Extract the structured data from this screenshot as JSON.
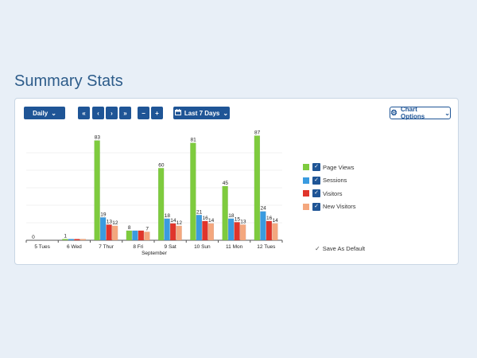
{
  "page": {
    "title": "Summary Stats"
  },
  "toolbar": {
    "period_label": "Daily",
    "nav": {
      "first": "«",
      "prev": "‹",
      "next": "›",
      "last": "»"
    },
    "zoom_out": "−",
    "zoom_in": "+",
    "range_label": "Last 7 Days",
    "chart_options_label": "Chart Options"
  },
  "legend": {
    "items": [
      {
        "label": "Page Views",
        "color": "#7ecb3e"
      },
      {
        "label": "Sessions",
        "color": "#3a9be0"
      },
      {
        "label": "Visitors",
        "color": "#e0352b"
      },
      {
        "label": "New Visitors",
        "color": "#f4a77e"
      }
    ]
  },
  "save_default_label": "Save As Default",
  "chart_data": {
    "type": "bar",
    "categories": [
      "5 Tues",
      "6 Wed",
      "7 Thur",
      "8 Fri",
      "9 Sat",
      "10 Sun",
      "11 Mon",
      "12 Tues"
    ],
    "xlabel": "September",
    "ylabel": "",
    "ylim": [
      0,
      90
    ],
    "grid": true,
    "series": [
      {
        "name": "Page Views",
        "color": "#7ecb3e",
        "values": [
          0,
          1,
          83,
          8,
          60,
          81,
          45,
          87
        ]
      },
      {
        "name": "Sessions",
        "color": "#3a9be0",
        "values": [
          0,
          1,
          19,
          8,
          18,
          21,
          18,
          24
        ]
      },
      {
        "name": "Visitors",
        "color": "#e0352b",
        "values": [
          0,
          1,
          13,
          8,
          14,
          16,
          15,
          16
        ]
      },
      {
        "name": "New Visitors",
        "color": "#f4a77e",
        "values": [
          0,
          1,
          12,
          7,
          12,
          14,
          13,
          14
        ]
      }
    ],
    "value_labels": [
      [
        "0",
        "",
        "",
        ""
      ],
      [
        "1",
        "",
        "",
        ""
      ],
      [
        "83",
        "19",
        "13",
        "12"
      ],
      [
        "8",
        "",
        "",
        "7"
      ],
      [
        "60",
        "18",
        "14",
        "12"
      ],
      [
        "81",
        "21",
        "16",
        "14"
      ],
      [
        "45",
        "18",
        "15",
        "13"
      ],
      [
        "87",
        "24",
        "16",
        "14"
      ]
    ]
  }
}
